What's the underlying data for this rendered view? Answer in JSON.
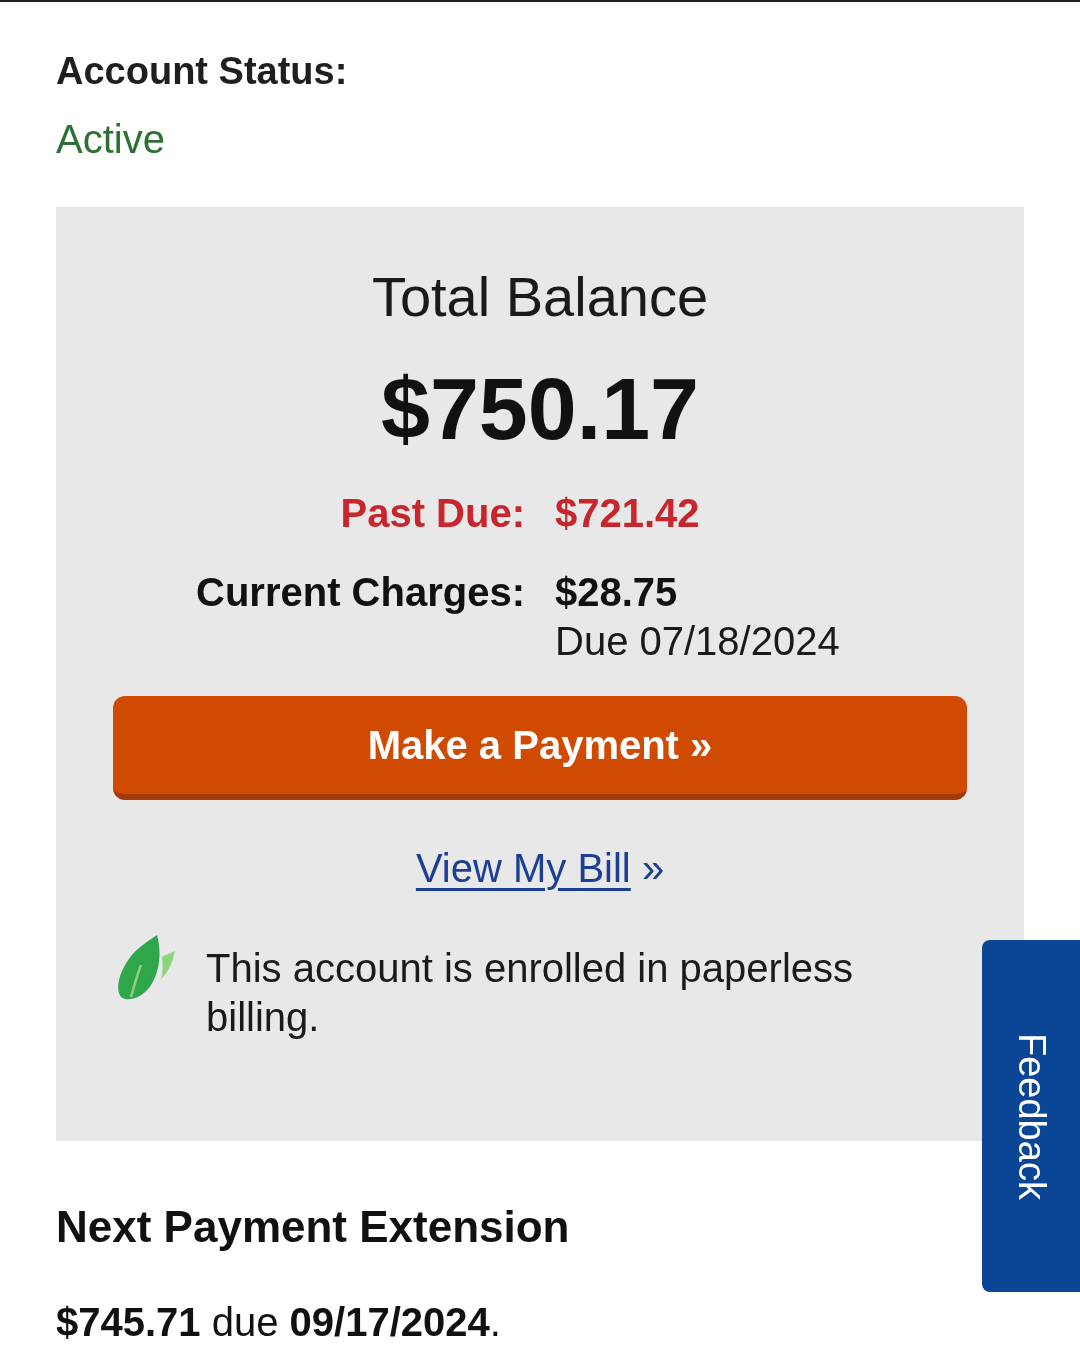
{
  "account_status": {
    "label": "Account Status:",
    "value": "Active"
  },
  "balance": {
    "title": "Total Balance",
    "amount": "$750.17",
    "lines": [
      {
        "kind": "past_due",
        "label": "Past Due:",
        "amount": "$721.42"
      },
      {
        "kind": "current",
        "label": "Current Charges:",
        "amount": "$28.75",
        "due": "Due 07/18/2024"
      }
    ]
  },
  "pay_button": {
    "label": "Make a Payment »"
  },
  "bill_link": {
    "label": "View My Bill",
    "suffix": "»"
  },
  "paperless": {
    "text": "This account is enrolled in paperless billing."
  },
  "extension": {
    "title": "Next Payment Extension",
    "text": "**$745.71** due **09/17/2024**."
  },
  "feedback_tab": {
    "label": "Feedback"
  }
}
